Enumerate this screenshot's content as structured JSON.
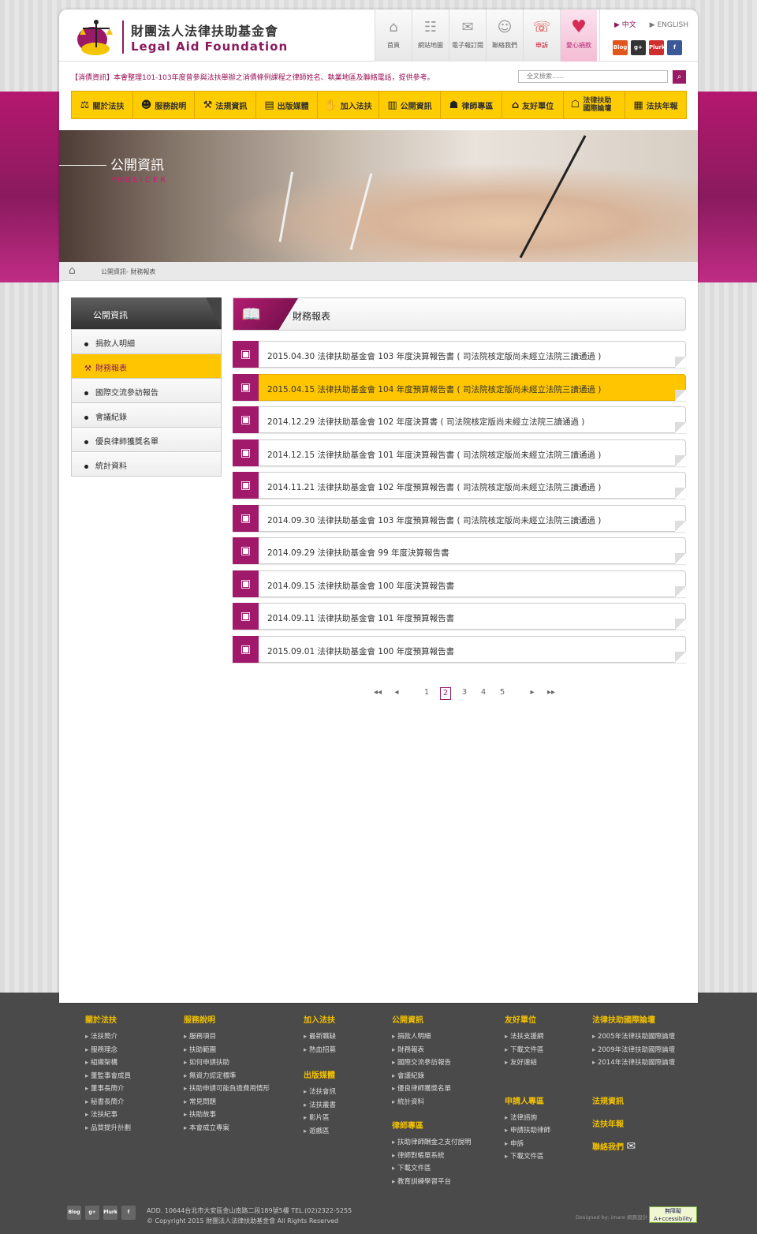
{
  "header": {
    "org_zh": "財團法人法律扶助基金會",
    "org_en": "Legal Aid Foundation",
    "topnav": [
      {
        "label": "首頁",
        "icon": "home-icon"
      },
      {
        "label": "網站地圖",
        "icon": "sitemap-icon"
      },
      {
        "label": "電子報訂閱",
        "icon": "mail-icon"
      },
      {
        "label": "聯絡我們",
        "icon": "contact-icon"
      },
      {
        "label": "申訴",
        "icon": "complaint-icon"
      },
      {
        "label": "愛心捐款",
        "icon": "heart-icon"
      }
    ],
    "lang_zh": "▶ 中文",
    "lang_en": "▶ ENGLISH",
    "social": [
      "Blog",
      "g+",
      "Plurk",
      "f"
    ],
    "news": "【消債資訊】本會整理101-103年度曾參與法扶舉辦之消債條例課程之律師姓名、執業地區及聯絡電話，提供參考。",
    "search_placeholder": "全文檢索......",
    "mainnav": [
      "關於法扶",
      "服務說明",
      "法規資訊",
      "出版媒體",
      "加入法扶",
      "公開資訊",
      "律師專區",
      "友好單位",
      "法律扶助國際論壇",
      "法扶年報"
    ]
  },
  "banner": {
    "title": "公開資訊",
    "subtitle": "PUBLICER"
  },
  "breadcrumb": "公開資訊- 財務報表",
  "sidebar": {
    "title": "公開資訊",
    "items": [
      "捐款人明細",
      "財務報表",
      "國際交流參訪報告",
      "會議紀錄",
      "優良律師獲獎名單",
      "統計資料"
    ],
    "active_index": 1
  },
  "content": {
    "title": "財務報表",
    "rows": [
      "2015.04.30  法律扶助基金會 103 年度決算報告書 ( 司法院核定版尚未經立法院三讀通過 )",
      "2015.04.15  法律扶助基金會 104 年度預算報告書 ( 司法院核定版尚未經立法院三讀通過 )",
      "2014.12.29  法律扶助基金會 102 年度決算書 ( 司法院核定版尚未經立法院三讀通過 )",
      "2014.12.15  法律扶助基金會 101 年度決算報告書 ( 司法院核定版尚未經立法院三讀通過 )",
      "2014.11.21  法律扶助基金會 102 年度預算報告書 ( 司法院核定版尚未經立法院三讀通過 )",
      "2014.09.30  法律扶助基金會 103 年度預算報告書 ( 司法院核定版尚未經立法院三讀通過 )",
      "2014.09.29  法律扶助基金會 99 年度決算報告書",
      "2014.09.15  法律扶助基金會 100 年度決算報告書",
      "2014.09.11  法律扶助基金會 101 年度預算報告書",
      "2015.09.01  法律扶助基金會 100 年度預算報告書"
    ],
    "highlight_index": 1,
    "pager": {
      "first": "◂◂",
      "prev": "◂",
      "pages": [
        "1",
        "2",
        "3",
        "4",
        "5"
      ],
      "current": "2",
      "next": "▸",
      "last": "▸▸"
    }
  },
  "footer": {
    "cols": [
      {
        "title": "關於法扶",
        "links": [
          "法扶簡介",
          "服務理念",
          "組織架構",
          "董監事會成員",
          "董事長簡介",
          "秘書長簡介",
          "法扶紀事",
          "品質提升計劃"
        ]
      },
      {
        "title": "服務說明",
        "links": [
          "服務項目",
          "扶助範圍",
          "如何申請扶助",
          "無資力認定標準",
          "扶助申請可能負擔費用情形",
          "常見問題",
          "扶助故事",
          "本會成立專案"
        ]
      },
      {
        "title": "加入法扶",
        "links": [
          "最新職缺",
          "熱血招募"
        ]
      },
      {
        "title": "出版媒體",
        "links": [
          "法扶會訊",
          "法扶叢書",
          "影片區",
          "遊戲區"
        ]
      },
      {
        "title": "公開資訊",
        "links": [
          "捐款人明細",
          "財務報表",
          "國際交流參訪報告",
          "會議紀錄",
          "優良律師獲獎名單",
          "統計資料"
        ]
      },
      {
        "title": "律師專區",
        "links": [
          "扶助律師酬金之支付說明",
          "律師對帳單系統",
          "下載文件區",
          "教育訓練學習平台"
        ]
      },
      {
        "title": "友好單位",
        "links": [
          "法扶支援網",
          "下載文件區",
          "友好連結"
        ]
      },
      {
        "title": "申請人專區",
        "links": [
          "法律諮詢",
          "申請扶助律師",
          "申訴",
          "下載文件區"
        ]
      },
      {
        "title": "法律扶助國際論壇",
        "links": [
          "2005年法律扶助國際論壇",
          "2009年法律扶助國際論壇",
          "2014年法律扶助國際論壇"
        ]
      },
      {
        "title": "法規資訊",
        "links": []
      },
      {
        "title": "法扶年報",
        "links": []
      },
      {
        "title": "聯絡我們",
        "links": []
      }
    ],
    "address": "ADD. 10644台北市大安區金山南路二段189號5樓   TEL.(02)2322-5255",
    "copyright": "© Copyright  2015   財團法人法律扶助基金會 All Rights Reserved",
    "designed": "Designed by: imare 網頁設計",
    "accessibility": "無障礙 A+ccessibility"
  }
}
